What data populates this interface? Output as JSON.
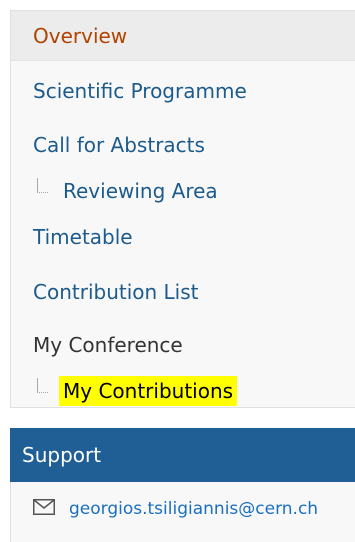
{
  "menu": {
    "items": [
      {
        "label": "Overview"
      },
      {
        "label": "Scientific Programme"
      },
      {
        "label": "Call for Abstracts"
      },
      {
        "label": "Reviewing Area"
      },
      {
        "label": "Timetable"
      },
      {
        "label": "Contribution List"
      },
      {
        "label": "My Conference"
      },
      {
        "label": "My Contributions"
      }
    ]
  },
  "support": {
    "title": "Support",
    "email": "georgios.tsiligiannis@cern.ch",
    "icon": "envelope-icon"
  },
  "colors": {
    "selected_text": "#b14300",
    "link": "#1c5b8c",
    "support_header_bg": "#1f5f96",
    "highlight": "#ffff00"
  }
}
